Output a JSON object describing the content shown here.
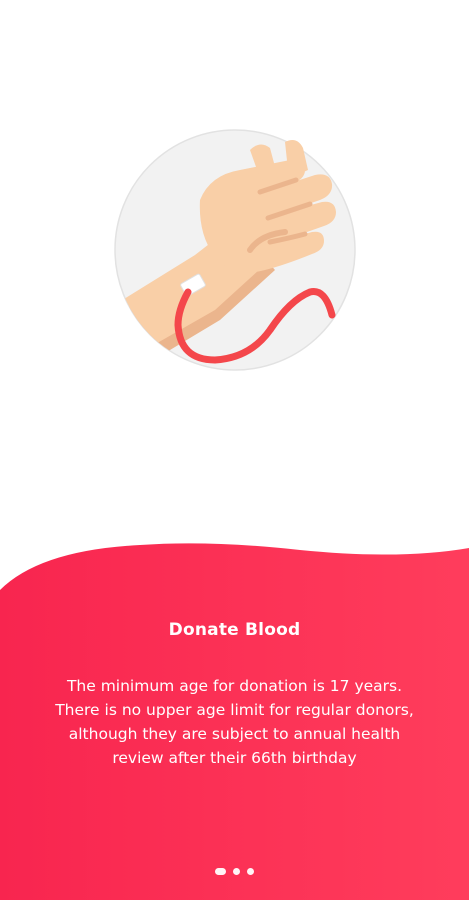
{
  "onboarding": {
    "title": "Donate Blood",
    "description": "The minimum age for donation is 17 years.\nThere is no upper age limit for regular donors,\nalthough they are subject to annual health\nreview after their 66th birthday",
    "illustration_icon": "hand-blood-donation-icon",
    "pager": {
      "pages": 3,
      "active": 1
    }
  },
  "colors": {
    "accent": "#F8254F",
    "accent_light": "#FF3D5C",
    "circle_bg": "#F2F2F2",
    "skin": "#F9CFA7",
    "skin_shadow": "#EBB58D",
    "tube": "#F4474B"
  }
}
